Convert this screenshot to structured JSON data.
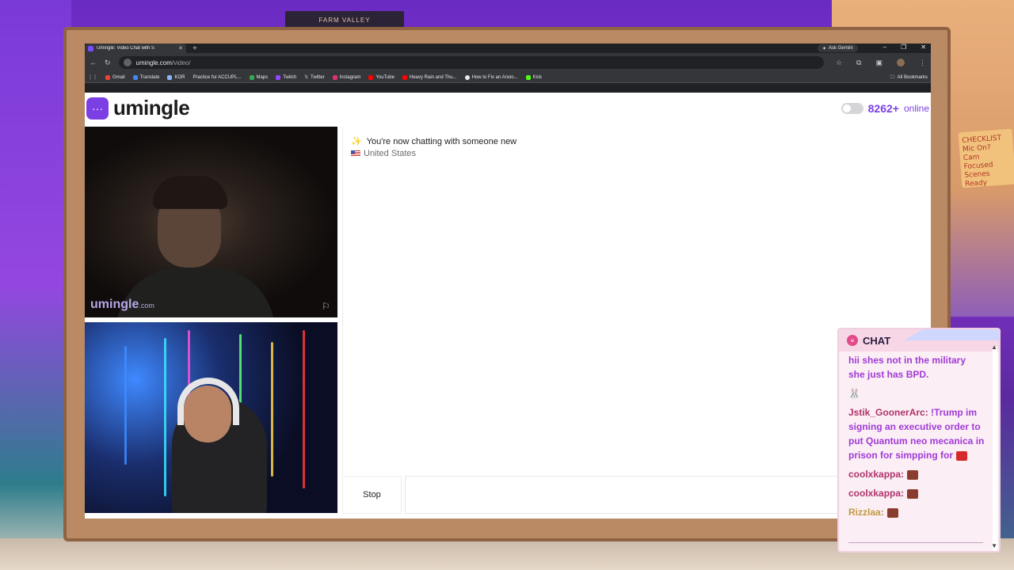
{
  "background": {
    "shelf_label": "FARM VALLEY",
    "poster_text": "CHECKLIST\nMic On?\nCam Focused\nScenes Ready"
  },
  "browser": {
    "tab_title": "Umingle: Video Chat with S",
    "new_tab_symbol": "+",
    "ask_gemini": "Ask Gemini",
    "url_host": "umingle.com",
    "url_path": "/video/",
    "bookmarks": [
      "Gmail",
      "Translate",
      "KOR",
      "Practice for ACCUPL...",
      "Maps",
      "Twitch",
      "Twitter",
      "Instagram",
      "YouTube",
      "Heavy Rain and Thu...",
      "How to Fix an Anxio...",
      "Kick"
    ],
    "all_bookmarks": "All Bookmarks"
  },
  "page": {
    "brand": "umingle",
    "online_count": "8262+",
    "online_label": "online",
    "watermark_main": "umingle",
    "watermark_suffix": ".com",
    "status_text": "You're now chatting with someone new",
    "status_emoji": "✨",
    "country": "United States",
    "stop_label": "Stop"
  },
  "stream_chat": {
    "title": "CHAT",
    "messages": [
      {
        "text": "hii shes not in the military she just has BPD."
      },
      {
        "text": "🐰"
      },
      {
        "user": "Jstik_GoonerArc",
        "text": "!Trump im signing an executive order to put Quantum neo mecanica in prison for simpping for"
      },
      {
        "user": "coolxkappa",
        "text": ""
      },
      {
        "user": "coolxkappa",
        "text": ""
      },
      {
        "user": "Rizzlaa",
        "text": ""
      }
    ]
  },
  "colors": {
    "accent": "#7b3fe4",
    "chat_user": "#b0336b",
    "chat_text": "#a03ad8"
  }
}
